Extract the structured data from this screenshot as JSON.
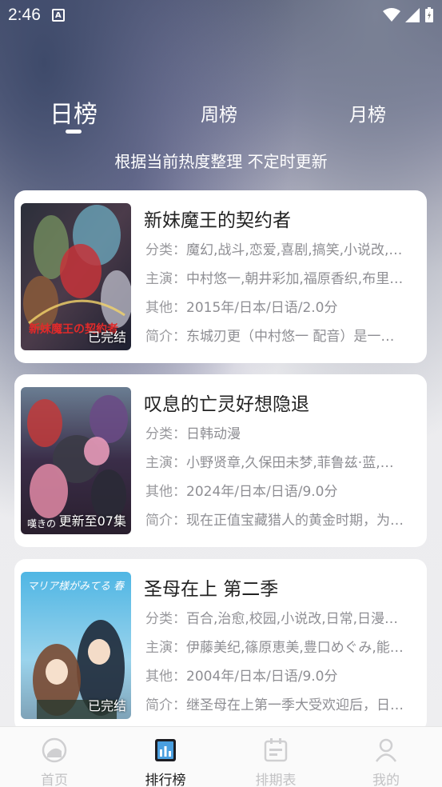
{
  "status_bar": {
    "time": "2:46",
    "notification_icon": "a-icon"
  },
  "tabs": [
    {
      "label": "日榜",
      "active": true
    },
    {
      "label": "周榜",
      "active": false
    },
    {
      "label": "月榜",
      "active": false
    }
  ],
  "subtitle": "根据当前热度整理 不定时更新",
  "meta_labels": {
    "genre": "分类：",
    "cast": "主演：",
    "other": "其他：",
    "intro": "简介："
  },
  "items": [
    {
      "title": "新妹魔王的契约者",
      "badge": "已完结",
      "genre": "魔幻,战斗,恋爱,喜剧,搞笑,小说改,…",
      "cast": "中村悠一,朝井彩加,福原香织,布里…",
      "other": "2015年/日本/日语/2.0分",
      "intro": "东城刃更（中村悠一 配音）是一…",
      "poster_text": "新妹魔王の契約者"
    },
    {
      "title": "叹息的亡灵好想隐退",
      "badge": "更新至07集",
      "genre": "日韩动漫",
      "cast": "小野贤章,久保田未梦,菲鲁兹·蓝,…",
      "other": "2024年/日本/日语/9.0分",
      "intro": "现在正值宝藏猎人的黄金时期，为…",
      "poster_text": "嘆きの"
    },
    {
      "title": "圣母在上 第二季",
      "badge": "已完结",
      "genre": "百合,治愈,校园,小说改,日常,日漫…",
      "cast": "伊藤美纪,篠原恵美,豊口めぐみ,能…",
      "other": "2004年/日本/日语/9.0分",
      "intro": "继圣母在上第一季大受欢迎后，日…",
      "poster_text": "マリア様がみてる 春"
    }
  ],
  "bottom_nav": [
    {
      "label": "首页",
      "icon": "home-icon",
      "active": false
    },
    {
      "label": "排行榜",
      "icon": "ranking-icon",
      "active": true
    },
    {
      "label": "排期表",
      "icon": "calendar-icon",
      "active": false
    },
    {
      "label": "我的",
      "icon": "profile-icon",
      "active": false
    }
  ],
  "colors": {
    "active_text": "#1a1a1a",
    "inactive_text": "#c2c2c4",
    "meta_text": "#8e8e93",
    "accent_icon": "#4a9fe0"
  }
}
